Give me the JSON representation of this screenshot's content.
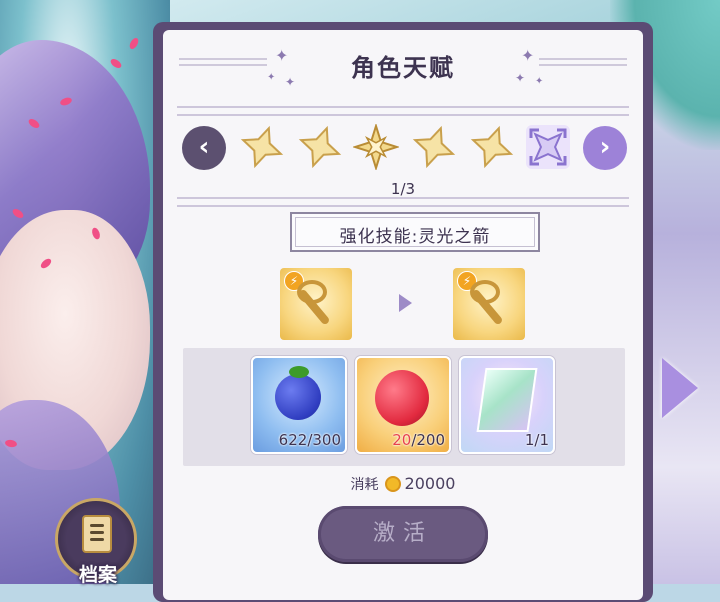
{
  "panel": {
    "title": "角色天赋",
    "page_indicator": "1/3",
    "current_level": 1,
    "total_levels": 3
  },
  "stars": [
    {
      "name": "talent-star-1",
      "state": "unlocked"
    },
    {
      "name": "talent-star-2",
      "state": "unlocked"
    },
    {
      "name": "talent-star-3",
      "state": "active"
    },
    {
      "name": "talent-star-4",
      "state": "unlocked"
    },
    {
      "name": "talent-star-5",
      "state": "unlocked"
    },
    {
      "name": "talent-star-6",
      "state": "locked"
    }
  ],
  "skill": {
    "name": "强化技能:灵光之箭"
  },
  "materials": [
    {
      "name": "blue-fruit",
      "count": "622",
      "need": "/300",
      "sufficient": true
    },
    {
      "name": "red-berry",
      "count": "20",
      "need": "/200",
      "sufficient": false
    },
    {
      "name": "character-shard",
      "count": "1",
      "need": "/1",
      "sufficient": true
    }
  ],
  "cost": {
    "label": "消耗",
    "amount": "20000"
  },
  "activate_label": "激活",
  "side": {
    "archive_label": "档案"
  },
  "colors": {
    "panel_frame": "#5b4b74",
    "accent": "#9d82d8",
    "insufficient": "#e8424e",
    "button": "#6a5a80"
  }
}
